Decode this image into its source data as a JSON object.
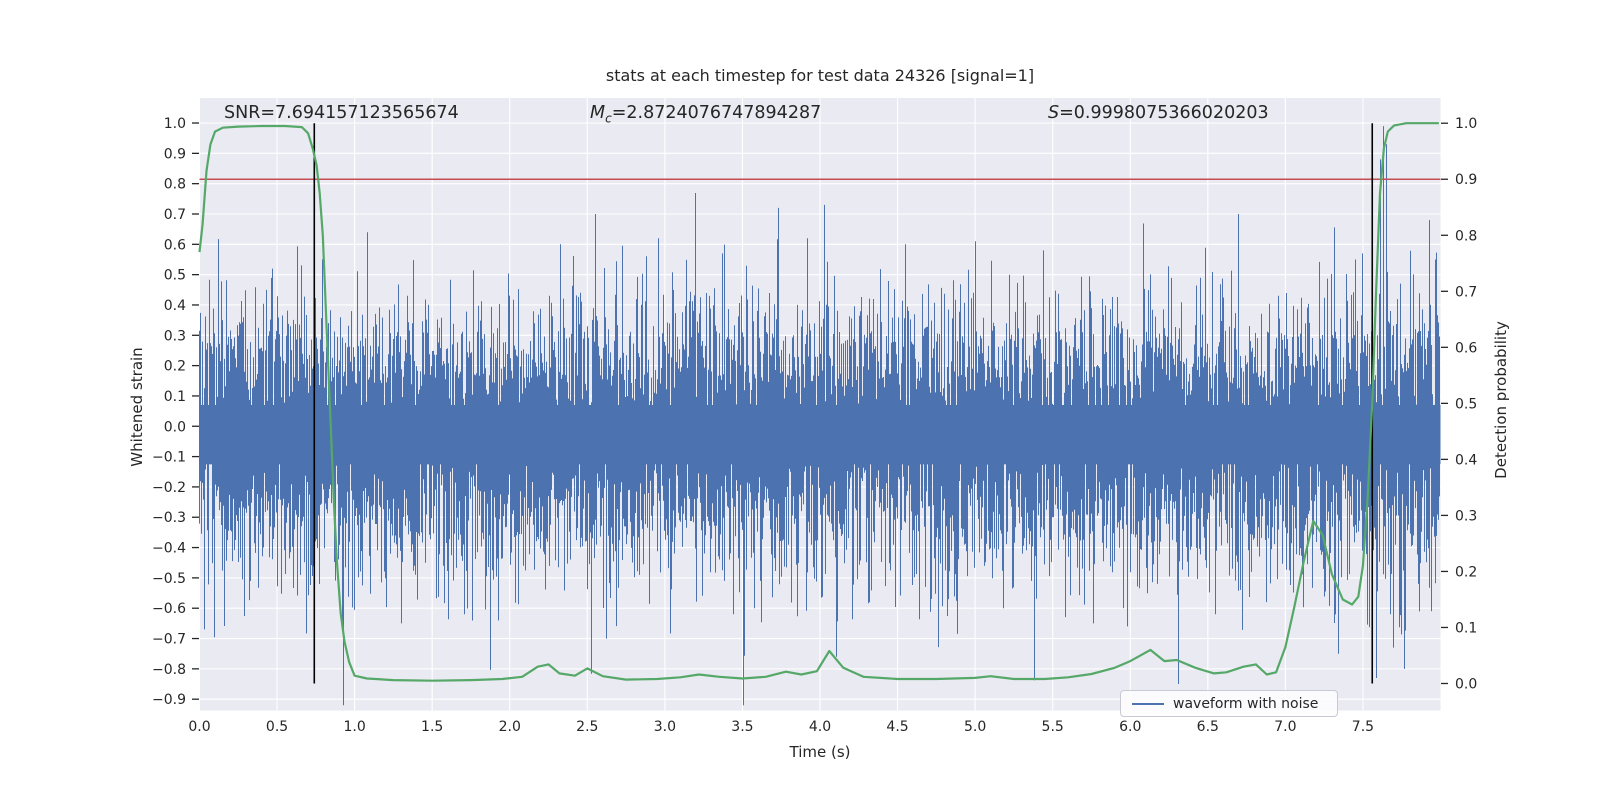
{
  "figure": {
    "background": "#ffffff",
    "plot_background": "#eaeaf2",
    "grid_color": "#ffffff",
    "text_color": "#262626"
  },
  "annotations": {
    "snr": {
      "prefix": "SNR",
      "value": "=7.694157123565674"
    },
    "chirp_mass": {
      "prefix": "M",
      "sub": "c",
      "value": "=2.8724076747894287"
    },
    "significance": {
      "prefix": "S",
      "value": "=0.9998075366020203"
    }
  },
  "chart_data": {
    "type": "line",
    "title": "stats at each timestep for test data 24326 [signal=1]",
    "xlabel": "Time (s)",
    "ylabel_left": "Whitened strain",
    "ylabel_right": "Detection probability",
    "xlim": [
      0,
      8
    ],
    "ylim_left": [
      -0.9373,
      1.0825
    ],
    "ylim_right": [
      -0.0482,
      1.045
    ],
    "xticks": [
      0.0,
      0.5,
      1.0,
      1.5,
      2.0,
      2.5,
      3.0,
      3.5,
      4.0,
      4.5,
      5.0,
      5.5,
      6.0,
      6.5,
      7.0,
      7.5
    ],
    "yticks_left": [
      1.0,
      0.9,
      0.8,
      0.7,
      0.6,
      0.5,
      0.4,
      0.3,
      0.2,
      0.1,
      0.0,
      -0.1,
      -0.2,
      -0.3,
      -0.4,
      -0.5,
      -0.6,
      -0.7,
      -0.8,
      -0.9
    ],
    "yticks_right": [
      1.0,
      0.9,
      0.8,
      0.7,
      0.6,
      0.5,
      0.4,
      0.3,
      0.2,
      0.1,
      0.0
    ],
    "grid": true,
    "threshold_line": {
      "axis": "right",
      "value": 0.9,
      "color": "#c44e52"
    },
    "vlines": {
      "color": "#000000",
      "x_values": [
        0.74,
        7.56
      ],
      "span_right_axis": [
        0.0,
        1.0
      ]
    },
    "legend": {
      "label": "waveform with noise",
      "position": "lower right"
    },
    "series": [
      {
        "name": "waveform with noise",
        "axis": "left",
        "color": "#4c72b0",
        "render": "noise-columns",
        "noise_model": {
          "seed": 123456789,
          "center": -0.025,
          "sigma_up": 0.21,
          "sigma_down": 0.23,
          "draws_per_column": 3,
          "min_up": 0.095,
          "min_down": 0.1,
          "solid_core_band": [
            -0.125,
            0.07
          ]
        },
        "feature_spikes": [
          [
            0.03,
            -0.67
          ],
          [
            0.47,
            0.52
          ],
          [
            1.08,
            0.64
          ],
          [
            1.3,
            -0.65
          ],
          [
            1.71,
            -0.62
          ],
          [
            2.33,
            0.6
          ],
          [
            2.55,
            0.7
          ],
          [
            2.96,
            0.62
          ],
          [
            3.37,
            0.57
          ],
          [
            3.44,
            -0.62
          ],
          [
            3.58,
            -0.6
          ],
          [
            3.73,
            0.72
          ],
          [
            3.92,
            0.62
          ],
          [
            4.03,
            0.73
          ],
          [
            4.32,
            -0.58
          ],
          [
            4.55,
            0.6
          ],
          [
            4.83,
            -0.57
          ],
          [
            5.0,
            0.61
          ],
          [
            5.18,
            -0.6
          ],
          [
            5.44,
            0.58
          ],
          [
            5.76,
            -0.65
          ],
          [
            5.98,
            -0.66
          ],
          [
            6.31,
            -0.85
          ],
          [
            6.55,
            -0.62
          ],
          [
            6.7,
            0.7
          ],
          [
            6.88,
            -0.58
          ],
          [
            7.34,
            -0.75
          ],
          [
            7.45,
            0.55
          ],
          [
            7.5,
            0.57
          ],
          [
            7.59,
            -0.83
          ],
          [
            7.61,
            0.88
          ],
          [
            7.63,
            0.99
          ],
          [
            7.655,
            0.93
          ],
          [
            7.68,
            -0.62
          ],
          [
            7.7,
            -0.73
          ],
          [
            7.77,
            -0.8
          ],
          [
            7.93,
            0.68
          ],
          [
            7.97,
            0.55
          ]
        ]
      },
      {
        "name": "detection probability",
        "axis": "right",
        "color": "#55a868",
        "render": "line",
        "points": [
          [
            0.0,
            0.77
          ],
          [
            0.02,
            0.82
          ],
          [
            0.045,
            0.915
          ],
          [
            0.07,
            0.962
          ],
          [
            0.1,
            0.985
          ],
          [
            0.15,
            0.992
          ],
          [
            0.25,
            0.994
          ],
          [
            0.4,
            0.995
          ],
          [
            0.55,
            0.995
          ],
          [
            0.66,
            0.993
          ],
          [
            0.7,
            0.982
          ],
          [
            0.73,
            0.955
          ],
          [
            0.755,
            0.925
          ],
          [
            0.775,
            0.875
          ],
          [
            0.795,
            0.8
          ],
          [
            0.815,
            0.665
          ],
          [
            0.84,
            0.5
          ],
          [
            0.865,
            0.33
          ],
          [
            0.885,
            0.22
          ],
          [
            0.91,
            0.125
          ],
          [
            0.935,
            0.075
          ],
          [
            0.965,
            0.038
          ],
          [
            1.0,
            0.014
          ],
          [
            1.08,
            0.009
          ],
          [
            1.25,
            0.006
          ],
          [
            1.5,
            0.005
          ],
          [
            1.75,
            0.006
          ],
          [
            1.95,
            0.008
          ],
          [
            2.08,
            0.012
          ],
          [
            2.18,
            0.03
          ],
          [
            2.25,
            0.034
          ],
          [
            2.32,
            0.018
          ],
          [
            2.42,
            0.014
          ],
          [
            2.5,
            0.027
          ],
          [
            2.6,
            0.013
          ],
          [
            2.75,
            0.007
          ],
          [
            2.95,
            0.008
          ],
          [
            3.1,
            0.011
          ],
          [
            3.22,
            0.016
          ],
          [
            3.35,
            0.012
          ],
          [
            3.5,
            0.009
          ],
          [
            3.65,
            0.012
          ],
          [
            3.78,
            0.021
          ],
          [
            3.88,
            0.016
          ],
          [
            3.98,
            0.022
          ],
          [
            4.06,
            0.058
          ],
          [
            4.15,
            0.028
          ],
          [
            4.28,
            0.012
          ],
          [
            4.5,
            0.008
          ],
          [
            4.75,
            0.008
          ],
          [
            5.0,
            0.01
          ],
          [
            5.1,
            0.013
          ],
          [
            5.25,
            0.008
          ],
          [
            5.45,
            0.008
          ],
          [
            5.6,
            0.011
          ],
          [
            5.75,
            0.017
          ],
          [
            5.9,
            0.028
          ],
          [
            6.0,
            0.04
          ],
          [
            6.13,
            0.06
          ],
          [
            6.22,
            0.04
          ],
          [
            6.3,
            0.042
          ],
          [
            6.42,
            0.028
          ],
          [
            6.54,
            0.018
          ],
          [
            6.62,
            0.02
          ],
          [
            6.73,
            0.03
          ],
          [
            6.81,
            0.034
          ],
          [
            6.88,
            0.016
          ],
          [
            6.94,
            0.02
          ],
          [
            7.0,
            0.065
          ],
          [
            7.06,
            0.14
          ],
          [
            7.12,
            0.22
          ],
          [
            7.18,
            0.29
          ],
          [
            7.24,
            0.265
          ],
          [
            7.3,
            0.195
          ],
          [
            7.37,
            0.15
          ],
          [
            7.43,
            0.141
          ],
          [
            7.47,
            0.155
          ],
          [
            7.5,
            0.21
          ],
          [
            7.53,
            0.33
          ],
          [
            7.56,
            0.5
          ],
          [
            7.585,
            0.7
          ],
          [
            7.61,
            0.875
          ],
          [
            7.635,
            0.955
          ],
          [
            7.66,
            0.985
          ],
          [
            7.7,
            0.996
          ],
          [
            7.78,
            1.0
          ],
          [
            7.9,
            1.0
          ],
          [
            7.99,
            1.0
          ]
        ]
      }
    ]
  }
}
